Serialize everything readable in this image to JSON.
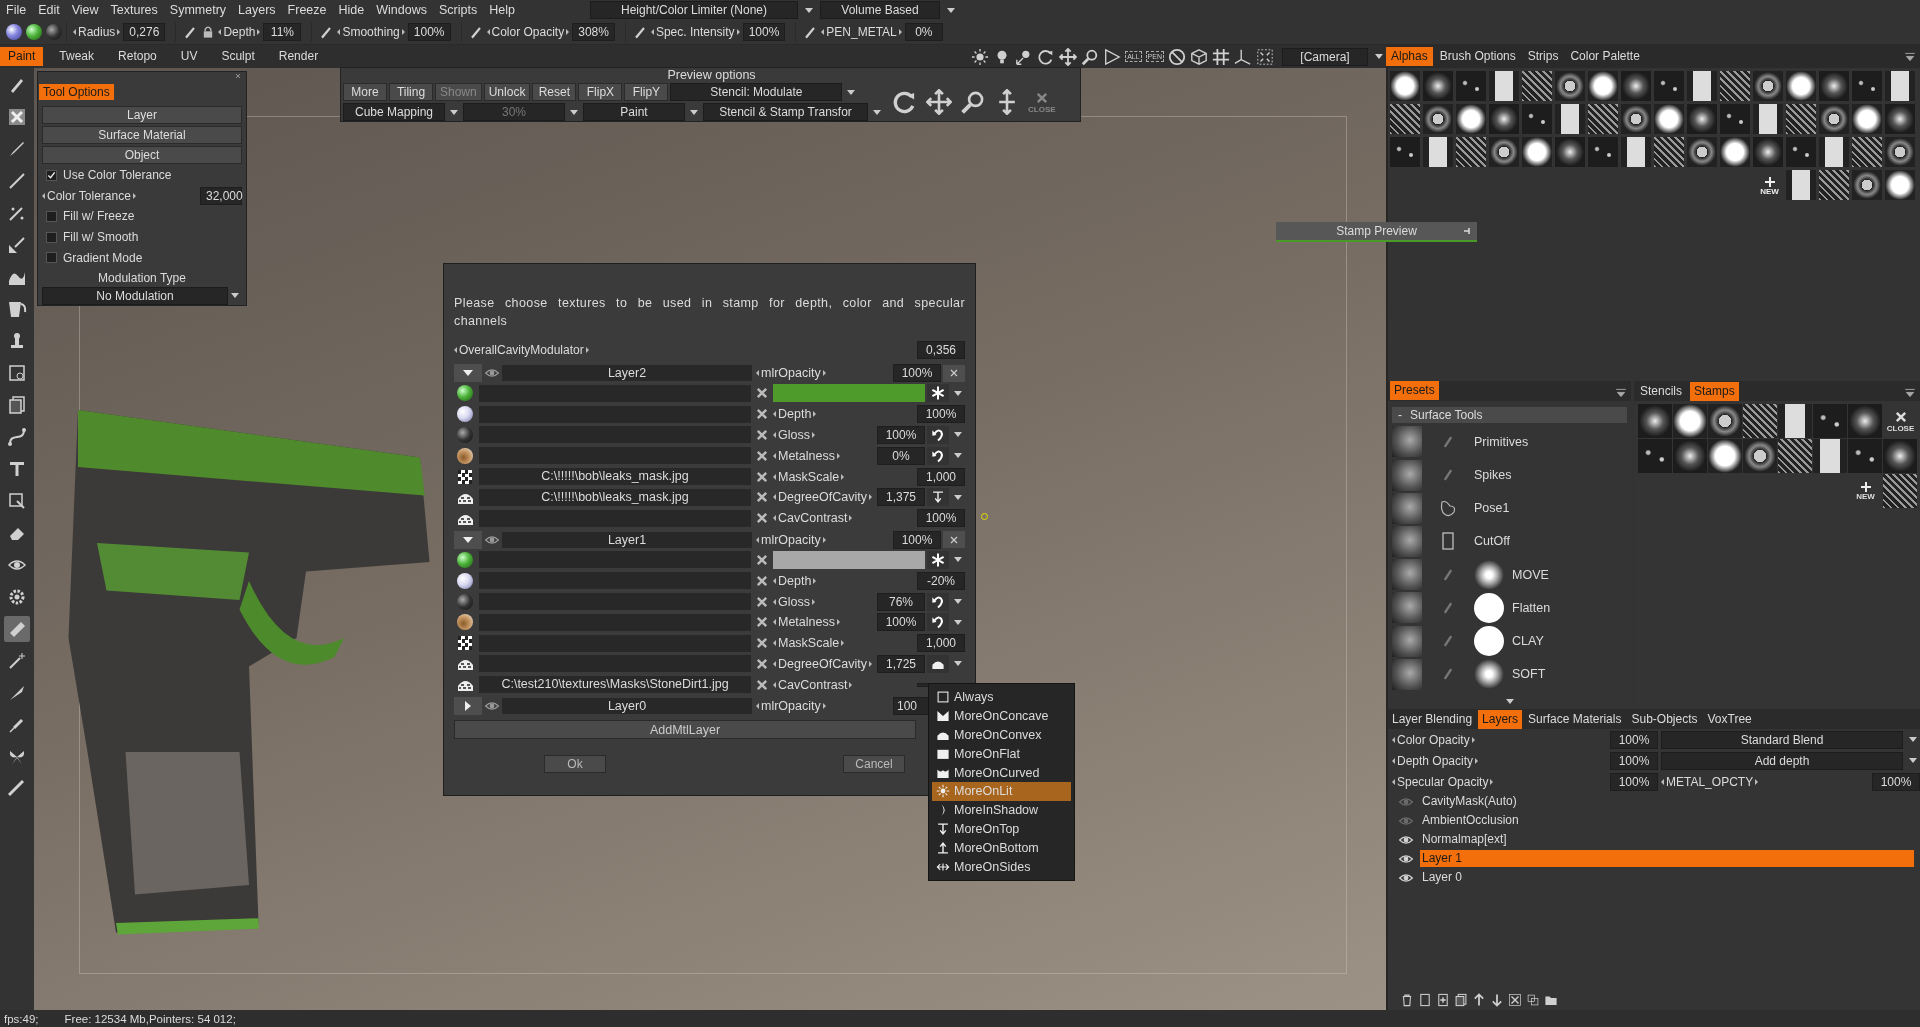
{
  "menu": [
    "File",
    "Edit",
    "View",
    "Textures",
    "Symmetry",
    "Layers",
    "Freeze",
    "Hide",
    "Windows",
    "Scripts",
    "Help"
  ],
  "top_dropdowns": [
    "Height/Color Limiter (None)",
    "Volume Based"
  ],
  "brush_params": [
    {
      "label": "Radius",
      "value": "0,276"
    },
    {
      "label": "Depth",
      "value": "11%"
    },
    {
      "label": "Smoothing",
      "value": "100%"
    },
    {
      "label": "Color Opacity",
      "value": "308%"
    },
    {
      "label": "Spec. Intensity",
      "value": "100%"
    },
    {
      "label": "PEN_METAL",
      "value": "0%"
    }
  ],
  "mode_tabs": [
    {
      "label": "Paint",
      "selected": true
    },
    {
      "label": "Tweak",
      "selected": false
    },
    {
      "label": "Retopo",
      "selected": false
    },
    {
      "label": "UV",
      "selected": false
    },
    {
      "label": "Sculpt",
      "selected": false
    },
    {
      "label": "Render",
      "selected": false
    }
  ],
  "view_labels": [
    "ALL",
    "PEN"
  ],
  "camera": "[Camera]",
  "right_tabs": [
    {
      "label": "Alphas",
      "selected": true
    },
    {
      "label": "Brush Options",
      "selected": false
    },
    {
      "label": "Strips",
      "selected": false
    },
    {
      "label": "Color Palette",
      "selected": false
    }
  ],
  "left_tools": [
    {
      "kind": "pen",
      "selected": false
    },
    {
      "kind": "cross",
      "selected": false
    },
    {
      "kind": "brush",
      "selected": false
    },
    {
      "kind": "line",
      "selected": false
    },
    {
      "kind": "splatter",
      "selected": false
    },
    {
      "kind": "brushfill",
      "selected": false
    },
    {
      "kind": "smudge",
      "selected": false
    },
    {
      "kind": "bucket",
      "selected": false
    },
    {
      "kind": "stamp",
      "selected": false
    },
    {
      "kind": "lasso",
      "selected": false
    },
    {
      "kind": "pages",
      "selected": false
    },
    {
      "kind": "curve",
      "selected": false
    },
    {
      "kind": "text",
      "selected": false
    },
    {
      "kind": "transform",
      "selected": false
    },
    {
      "kind": "eraser",
      "selected": false
    },
    {
      "kind": "eye",
      "selected": false
    },
    {
      "kind": "gear",
      "selected": false
    },
    {
      "kind": "ruler",
      "selected": true
    },
    {
      "kind": "wand",
      "selected": false
    },
    {
      "kind": "knife",
      "selected": false
    },
    {
      "kind": "syringe",
      "selected": false
    },
    {
      "kind": "butterfly",
      "selected": false
    },
    {
      "kind": "measure",
      "selected": false
    }
  ],
  "tool_options": {
    "title": "Tool Options",
    "buttons": [
      "Layer",
      "Surface Material",
      "Object"
    ],
    "rows": [
      {
        "kind": "check",
        "label": "Use Color Tolerance",
        "checked": true
      },
      {
        "kind": "param",
        "label": "Color Tolerance",
        "value": "32,000"
      },
      {
        "kind": "check",
        "label": "Fill w/ Freeze",
        "checked": false
      },
      {
        "kind": "check",
        "label": "Fill w/ Smooth",
        "checked": false
      },
      {
        "kind": "check",
        "label": "Gradient Mode",
        "checked": false
      }
    ],
    "modulation_label": "Modulation Type",
    "modulation": "No Modulation"
  },
  "preview_options": {
    "title": "Preview options",
    "buttons": [
      {
        "label": "More",
        "disabled": false
      },
      {
        "label": "Tiling",
        "disabled": false
      },
      {
        "label": "Shown",
        "disabled": true
      },
      {
        "label": "Unlock",
        "disabled": false
      },
      {
        "label": "Reset",
        "disabled": false
      },
      {
        "label": "FlipX",
        "disabled": false
      },
      {
        "label": "FlipY",
        "disabled": false
      }
    ],
    "stencil": "Stencil: Modulate",
    "dropdowns": [
      {
        "label": "Cube Mapping",
        "disabled": false
      },
      {
        "label": "30%",
        "disabled": true
      },
      {
        "label": "Paint",
        "disabled": false
      },
      {
        "label": "Stencil & Stamp Transfor",
        "disabled": false
      }
    ],
    "close": "CLOSE"
  },
  "stamp_preview": {
    "title": "Stamp Preview"
  },
  "dialog": {
    "message": "Please choose textures to be used in stamp for depth, color and specular channels",
    "overall": {
      "label": "OverallCavityModulator",
      "value": "0,356"
    },
    "layers": [
      {
        "name": "Layer2",
        "expanded": true,
        "opacity_label": "mlrOpacity",
        "opacity": "100%",
        "rows": [
          {
            "kind": "color",
            "color": "#4e9a2a"
          },
          {
            "kind": "depth",
            "label": "Depth",
            "value": "100%"
          },
          {
            "kind": "gloss",
            "label": "Gloss",
            "value": "100%"
          },
          {
            "kind": "metal",
            "label": "Metalness",
            "value": "0%"
          },
          {
            "kind": "mask",
            "path": "C:\\!!!!!\\bob\\leaks_mask.jpg",
            "label": "MaskScale",
            "value": "1,000"
          },
          {
            "kind": "cavity",
            "path": "C:\\!!!!!\\bob\\leaks_mask.jpg",
            "label": "DegreeOfCavity",
            "value": "1,375",
            "mode": {
              "kind": "top"
            }
          },
          {
            "kind": "contrast",
            "label": "CavContrast",
            "value": "100%"
          }
        ]
      },
      {
        "name": "Layer1",
        "expanded": true,
        "opacity_label": "mlrOpacity",
        "opacity": "100%",
        "rows": [
          {
            "kind": "color",
            "color": "#a8a8a8"
          },
          {
            "kind": "depth",
            "label": "Depth",
            "value": "-20%"
          },
          {
            "kind": "gloss",
            "label": "Gloss",
            "value": "76%"
          },
          {
            "kind": "metal",
            "label": "Metalness",
            "value": "100%"
          },
          {
            "kind": "mask",
            "label": "MaskScale",
            "value": "1,000"
          },
          {
            "kind": "cavity",
            "label": "DegreeOfCavity",
            "value": "1,725",
            "mode": {
              "kind": "convex"
            }
          },
          {
            "kind": "contrast",
            "path": "C:\\test210\\textures\\Masks\\StoneDirt1.jpg",
            "label": "CavContrast"
          }
        ]
      },
      {
        "name": "Layer0",
        "expanded": false,
        "opacity_label": "mlrOpacity",
        "opacity": "100"
      }
    ],
    "add_button": "AddMtlLayer",
    "ok": "Ok",
    "cancel": "Cancel"
  },
  "cavity_menu": [
    {
      "kind": "always",
      "label": "Always",
      "selected": false
    },
    {
      "kind": "concave",
      "label": "MoreOnConcave",
      "selected": false
    },
    {
      "kind": "convex",
      "label": "MoreOnConvex",
      "selected": false
    },
    {
      "kind": "flat",
      "label": "MoreOnFlat",
      "selected": false
    },
    {
      "kind": "curved",
      "label": "MoreOnCurved",
      "selected": false
    },
    {
      "kind": "lit",
      "label": "MoreOnLit",
      "selected": true
    },
    {
      "kind": "shadow",
      "label": "MoreInShadow",
      "selected": false
    },
    {
      "kind": "top",
      "label": "MoreOnTop",
      "selected": false
    },
    {
      "kind": "bottom",
      "label": "MoreOnBottom",
      "selected": false
    },
    {
      "kind": "sides",
      "label": "MoreOnSides",
      "selected": false
    }
  ],
  "alphas": {
    "new": "NEW"
  },
  "presets": {
    "tab": "Presets",
    "group": {
      "toggle": "-",
      "label": "Surface Tools"
    },
    "items": [
      {
        "kind": "pen",
        "label": "Primitives"
      },
      {
        "kind": "pen",
        "label": "Spikes"
      },
      {
        "kind": "pose",
        "label": "Pose1"
      },
      {
        "kind": "cutoff",
        "label": "CutOff"
      },
      {
        "kind": "soft",
        "label": "MOVE"
      },
      {
        "kind": "solid",
        "label": "Flatten"
      },
      {
        "kind": "solid",
        "label": "CLAY"
      },
      {
        "kind": "soft",
        "label": "SOFT"
      }
    ]
  },
  "stamps": {
    "tabs": [
      {
        "label": "Stencils",
        "selected": false
      },
      {
        "label": "Stamps",
        "selected": true
      }
    ],
    "close": "CLOSE",
    "new": "NEW"
  },
  "layers_panel": {
    "tabs": [
      {
        "label": "Layer Blending",
        "selected": false
      },
      {
        "label": "Layers",
        "selected": true
      },
      {
        "label": "Surface Materials",
        "selected": false
      },
      {
        "label": "Sub-Objects",
        "selected": false
      },
      {
        "label": "VoxTree",
        "selected": false
      }
    ],
    "params": [
      {
        "label": "Color Opacity",
        "value": "100%",
        "blend": "Standard Blend"
      },
      {
        "label": "Depth Opacity",
        "value": "100%",
        "blend": "Add depth"
      },
      {
        "label": "Specular Opacity",
        "value": "100%",
        "extra_label": "METAL_OPCTY",
        "extra_value": "100%"
      }
    ],
    "layers": [
      {
        "name": "CavityMask(Auto)",
        "visible": false,
        "selected": false
      },
      {
        "name": "AmbientOcclusion",
        "visible": false,
        "selected": false
      },
      {
        "name": "Normalmap[ext]",
        "visible": true,
        "selected": false
      },
      {
        "name": "Layer 1",
        "visible": true,
        "selected": true
      },
      {
        "name": "Layer 0",
        "visible": true,
        "selected": false
      }
    ]
  },
  "status": [
    "fps:49;",
    "Free: 12534 Mb,Pointers: 54 012;"
  ]
}
